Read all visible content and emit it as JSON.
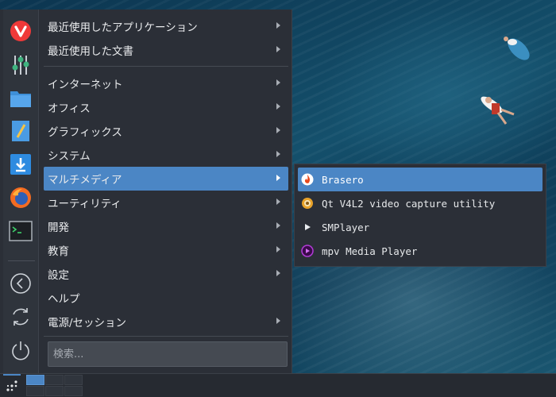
{
  "menu": {
    "items": [
      {
        "label": "最近使用したアプリケーション"
      },
      {
        "label": "最近使用した文書"
      },
      {
        "label": "インターネット"
      },
      {
        "label": "オフィス"
      },
      {
        "label": "グラフィックス"
      },
      {
        "label": "システム"
      },
      {
        "label": "マルチメディア",
        "active": true
      },
      {
        "label": "ユーティリティ"
      },
      {
        "label": "開発"
      },
      {
        "label": "教育"
      },
      {
        "label": "設定"
      },
      {
        "label": "ヘルプ"
      },
      {
        "label": "電源/セッション"
      }
    ],
    "search_placeholder": "検索..."
  },
  "favorites": [
    {
      "icon": "vivaldi-icon"
    },
    {
      "icon": "settings-mixer-icon"
    },
    {
      "icon": "folder-icon"
    },
    {
      "icon": "text-editor-icon"
    },
    {
      "icon": "download-icon"
    },
    {
      "icon": "firefox-icon"
    },
    {
      "icon": "terminal-icon"
    },
    {
      "icon": "lock-screen-icon"
    },
    {
      "icon": "logout-icon"
    },
    {
      "icon": "power-icon"
    }
  ],
  "submenu": {
    "items": [
      {
        "label": "Brasero",
        "icon": "brasero-icon"
      },
      {
        "label": "Qt V4L2 video capture utility",
        "icon": "qv4l2-icon"
      },
      {
        "label": "SMPlayer",
        "icon": "smplayer-icon"
      },
      {
        "label": "mpv Media Player",
        "icon": "mpv-icon"
      }
    ]
  },
  "taskbar": {
    "desktops": 6,
    "current_desktop": 1
  },
  "colors": {
    "accent": "#4b86c5",
    "menu_bg": "#2b2f37",
    "taskbar_bg": "#262a31"
  }
}
